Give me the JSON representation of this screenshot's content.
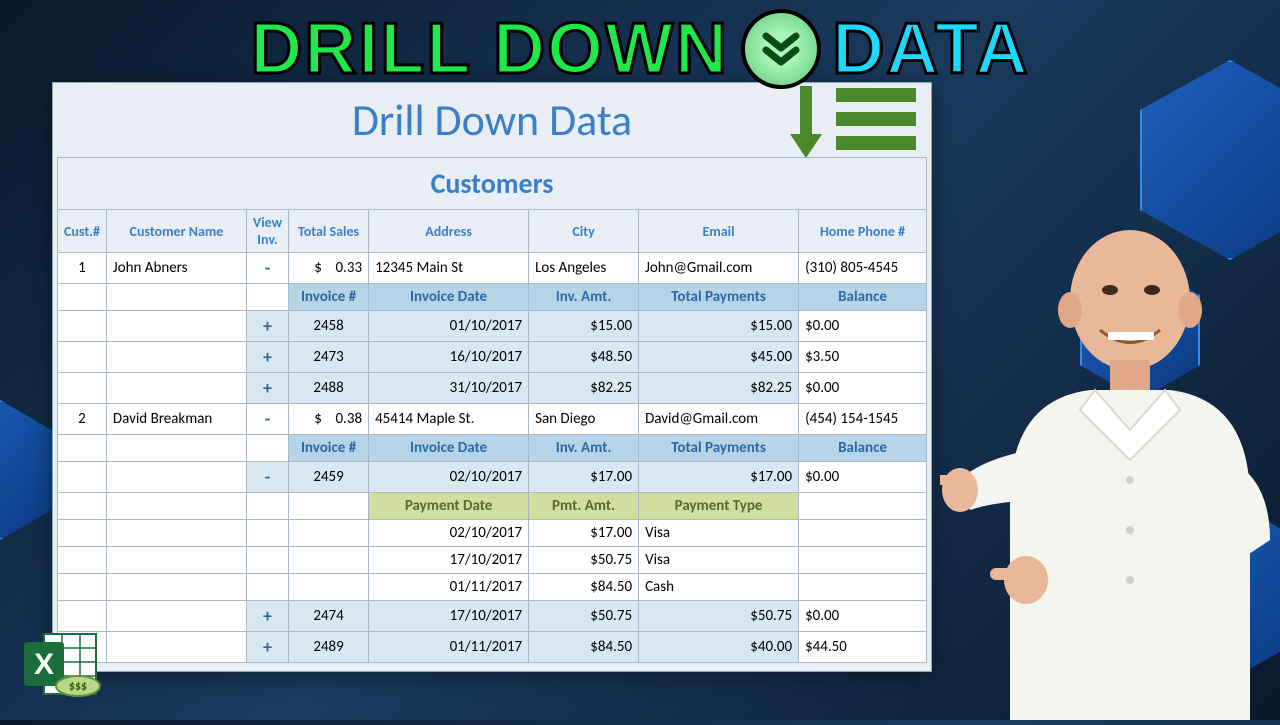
{
  "title": {
    "word1": "DRILL DOWN",
    "word2": "DATA"
  },
  "sheet_title": "Drill Down Data",
  "table_title": "Customers",
  "col_heads": [
    "Cust.#",
    "Customer Name",
    "View Inv.",
    "Total Sales",
    "Address",
    "City",
    "Email",
    "Home Phone #"
  ],
  "inv_heads": [
    "Invoice #",
    "Invoice Date",
    "Inv. Amt.",
    "Total Payments",
    "Balance"
  ],
  "pay_heads": [
    "Payment Date",
    "Pmt. Amt.",
    "Payment Type"
  ],
  "cust1": {
    "id": "1",
    "name": "John Abners",
    "tot": "0.33",
    "addr": "12345 Main St",
    "city": "Los Angeles",
    "email": "John@Gmail.com",
    "phone": "(310) 805-4545"
  },
  "cust1_inv": [
    {
      "num": "2458",
      "date": "01/10/2017",
      "amt": "$15.00",
      "pay": "$15.00",
      "bal": "$0.00"
    },
    {
      "num": "2473",
      "date": "16/10/2017",
      "amt": "$48.50",
      "pay": "$45.00",
      "bal": "$3.50"
    },
    {
      "num": "2488",
      "date": "31/10/2017",
      "amt": "$82.25",
      "pay": "$82.25",
      "bal": "$0.00"
    }
  ],
  "cust2": {
    "id": "2",
    "name": "David Breakman",
    "tot": "0.38",
    "addr": "45414 Maple St.",
    "city": "San Diego",
    "email": "David@Gmail.com",
    "phone": "(454) 154-1545"
  },
  "cust2_inv1": {
    "num": "2459",
    "date": "02/10/2017",
    "amt": "$17.00",
    "pay": "$17.00",
    "bal": "$0.00"
  },
  "cust2_pay": [
    {
      "date": "02/10/2017",
      "amt": "$17.00",
      "type": "Visa"
    },
    {
      "date": "17/10/2017",
      "amt": "$50.75",
      "type": "Visa"
    },
    {
      "date": "01/11/2017",
      "amt": "$84.50",
      "type": "Cash"
    }
  ],
  "cust2_inv_rest": [
    {
      "num": "2474",
      "date": "17/10/2017",
      "amt": "$50.75",
      "pay": "$50.75",
      "bal": "$0.00"
    },
    {
      "num": "2489",
      "date": "01/11/2017",
      "amt": "$84.50",
      "pay": "$40.00",
      "bal": "$44.50"
    }
  ],
  "toggle": {
    "plus": "+",
    "minus": "-"
  },
  "currency": "$"
}
